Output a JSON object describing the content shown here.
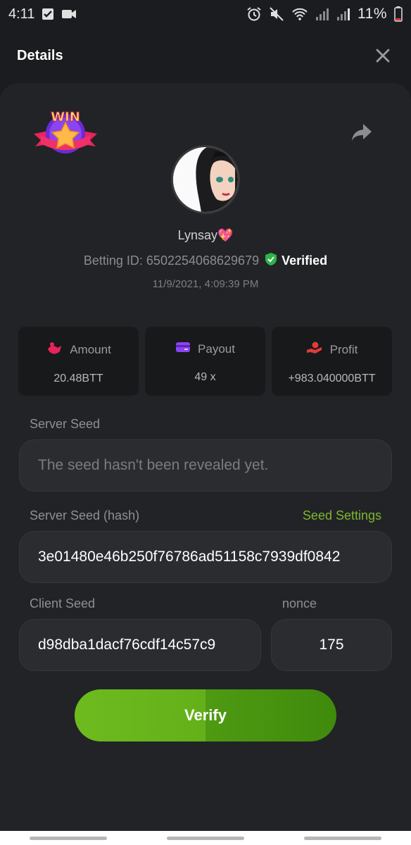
{
  "status_bar": {
    "time": "4:11",
    "battery": "11%",
    "icons": [
      "checkbox-icon",
      "video-icon",
      "alarm-icon",
      "mute-icon",
      "wifi-icon",
      "signal-icon",
      "signal-icon",
      "battery-icon"
    ]
  },
  "header": {
    "title": "Details",
    "close_icon": "close-icon"
  },
  "bet": {
    "badge_icon": "win-badge-icon",
    "share_icon": "share-icon",
    "username": "Lynsay💖",
    "betting_id": "Betting ID: 6502254068629679",
    "verified_label": "Verified",
    "timestamp": "11/9/2021, 4:09:39 PM"
  },
  "stats": [
    {
      "icon": "amount-icon",
      "label": "Amount",
      "value": "20.48BTT"
    },
    {
      "icon": "payout-icon",
      "label": "Payout",
      "value": "49 x"
    },
    {
      "icon": "profit-icon",
      "label": "Profit",
      "value": "+983.040000BTT"
    }
  ],
  "server_seed": {
    "label": "Server Seed",
    "placeholder": "The seed hasn't been revealed yet."
  },
  "server_seed_hash": {
    "label": "Server Seed (hash)",
    "value": "3e01480e46b250f76786ad51158c7939df0842",
    "link": "Seed Settings"
  },
  "client_seed": {
    "label": "Client Seed",
    "value": "d98dba1dacf76cdf14c57c9"
  },
  "nonce": {
    "label": "nonce",
    "value": "175"
  },
  "verify_button": "Verify",
  "colors": {
    "accent": "#7cb82f",
    "background": "#1b1c1f",
    "card": "#222326",
    "verified_shield": "#2fb34a"
  }
}
